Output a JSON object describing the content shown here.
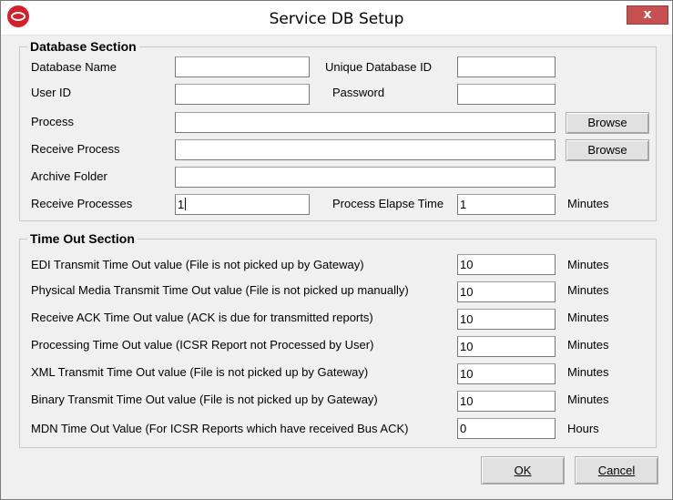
{
  "window": {
    "title": "Service DB Setup",
    "close_label": "x",
    "accent": "#d4202a"
  },
  "database_section": {
    "legend": "Database Section",
    "database_name": {
      "label": "Database Name",
      "value": ""
    },
    "unique_database_id": {
      "label": "Unique Database ID",
      "value": ""
    },
    "user_id": {
      "label": "User ID",
      "value": ""
    },
    "password": {
      "label": "Password",
      "value": ""
    },
    "process": {
      "label": "Process",
      "value": "",
      "browse": "Browse"
    },
    "receive_process": {
      "label": "Receive Process",
      "value": "",
      "browse": "Browse"
    },
    "archive_folder": {
      "label": "Archive Folder",
      "value": ""
    },
    "receive_processes": {
      "label": "Receive Processes",
      "value": "1"
    },
    "process_elapse_time": {
      "label": "Process Elapse Time",
      "value": "1",
      "unit": "Minutes"
    }
  },
  "timeout_section": {
    "legend": "Time Out Section",
    "rows": [
      {
        "label": "EDI Transmit Time Out value  (File is not picked up by Gateway)",
        "value": "10",
        "unit": "Minutes"
      },
      {
        "label": "Physical Media Transmit Time Out value (File is not picked up manually)",
        "value": "10",
        "unit": "Minutes"
      },
      {
        "label": "Receive ACK Time Out value (ACK is due for transmitted reports)",
        "value": "10",
        "unit": "Minutes"
      },
      {
        "label": "Processing Time Out value  (ICSR Report not Processed by User)",
        "value": "10",
        "unit": "Minutes"
      },
      {
        "label": "XML Transmit Time Out value (File is not picked up by Gateway)",
        "value": "10",
        "unit": "Minutes"
      },
      {
        "label": "Binary Transmit Time Out value (File is not picked up by Gateway)",
        "value": "10",
        "unit": "Minutes"
      },
      {
        "label": "MDN Time Out Value (For ICSR Reports which have received Bus ACK)",
        "value": "0",
        "unit": "Hours"
      }
    ]
  },
  "footer": {
    "ok_label": "OK",
    "cancel_label": "Cancel"
  }
}
